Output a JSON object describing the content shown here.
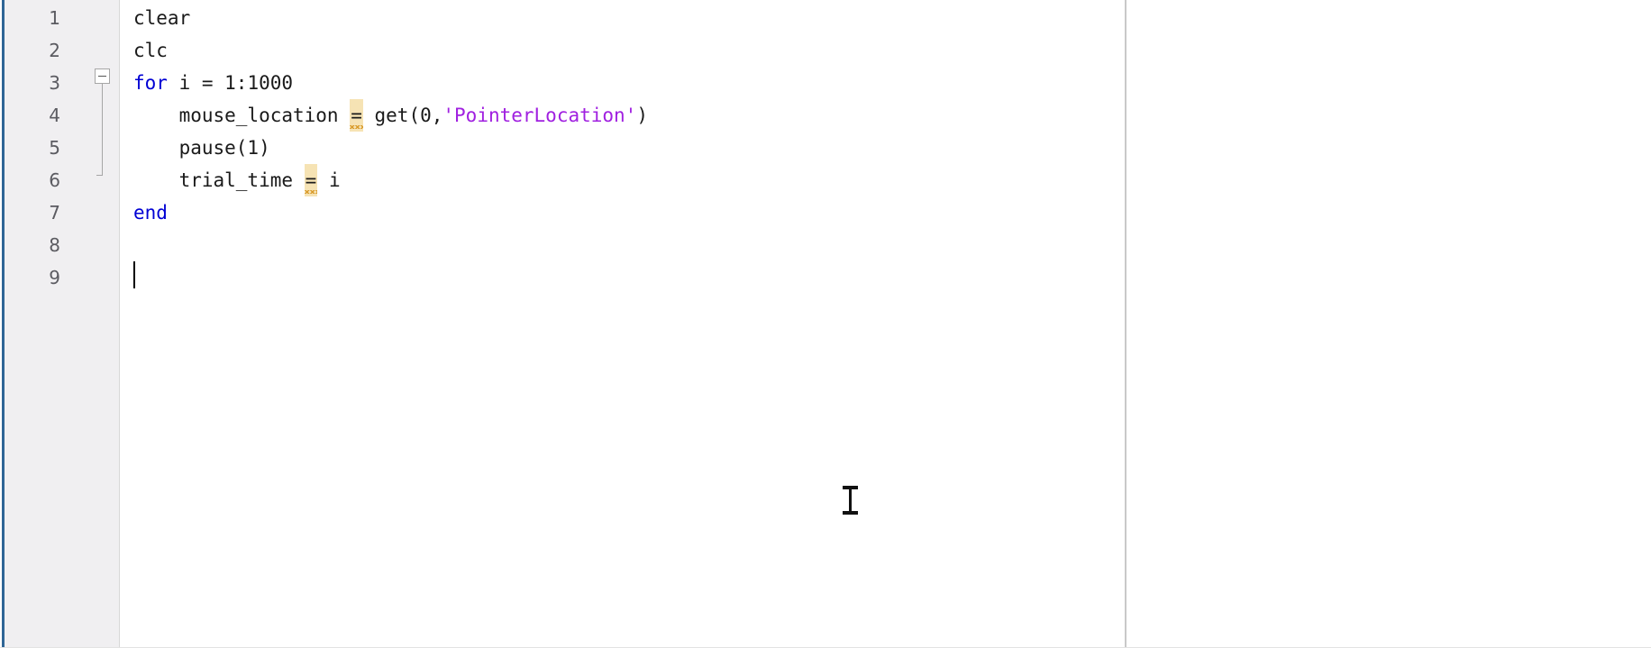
{
  "app": {
    "name": "MATLAB Editor",
    "document_state": "unsaved-script"
  },
  "gutter": {
    "name": "line-number-gutter",
    "line_numbers": [
      "1",
      "2",
      "3",
      "4",
      "5",
      "6",
      "7",
      "8",
      "9"
    ],
    "background_color": "#f0eff1",
    "text_color": "#5b5b61"
  },
  "fold": {
    "marker_symbol": "−",
    "marker_state": "expanded",
    "start_line": "3",
    "end_line": "7"
  },
  "editor": {
    "background_color": "#ffffff",
    "keyword_color": "#0000d4",
    "string_color": "#a020e0",
    "text_color": "#1a1a1a",
    "warning_highlight_color": "#f6e3b4",
    "warning_squiggle_color": "#d99b2b",
    "caret_line": "9",
    "lines": [
      {
        "number": "1",
        "text": "clear",
        "tokens": [
          {
            "t": "clear",
            "k": "plain"
          }
        ]
      },
      {
        "number": "2",
        "text": "clc",
        "tokens": [
          {
            "t": "clc",
            "k": "plain"
          }
        ]
      },
      {
        "number": "3",
        "text": "for i = 1:1000",
        "tokens": [
          {
            "t": "for",
            "k": "kw"
          },
          {
            "t": " i = 1:1000",
            "k": "plain"
          }
        ]
      },
      {
        "number": "4",
        "text": "    mouse_location = get(0,'PointerLocation')",
        "tokens": [
          {
            "t": "    mouse_location ",
            "k": "plain"
          },
          {
            "t": "=",
            "k": "warnop"
          },
          {
            "t": " get(0,",
            "k": "plain"
          },
          {
            "t": "'PointerLocation'",
            "k": "str"
          },
          {
            "t": ")",
            "k": "plain"
          }
        ]
      },
      {
        "number": "5",
        "text": "    pause(1)",
        "tokens": [
          {
            "t": "    pause(1)",
            "k": "plain"
          }
        ]
      },
      {
        "number": "6",
        "text": "    trial_time = i",
        "tokens": [
          {
            "t": "    trial_time ",
            "k": "plain"
          },
          {
            "t": "=",
            "k": "warnop"
          },
          {
            "t": " i",
            "k": "plain"
          }
        ]
      },
      {
        "number": "7",
        "text": "end",
        "tokens": [
          {
            "t": "end",
            "k": "kw"
          }
        ]
      },
      {
        "number": "8",
        "text": "",
        "tokens": []
      },
      {
        "number": "9",
        "text": "",
        "tokens": []
      }
    ]
  },
  "right_panel": {
    "name": "adjacent-empty-panel",
    "background_color": "#ffffff"
  },
  "mouse": {
    "shape": "i-beam",
    "x": "943",
    "y": "555"
  },
  "focus_accent": {
    "color": "#2f6596"
  }
}
